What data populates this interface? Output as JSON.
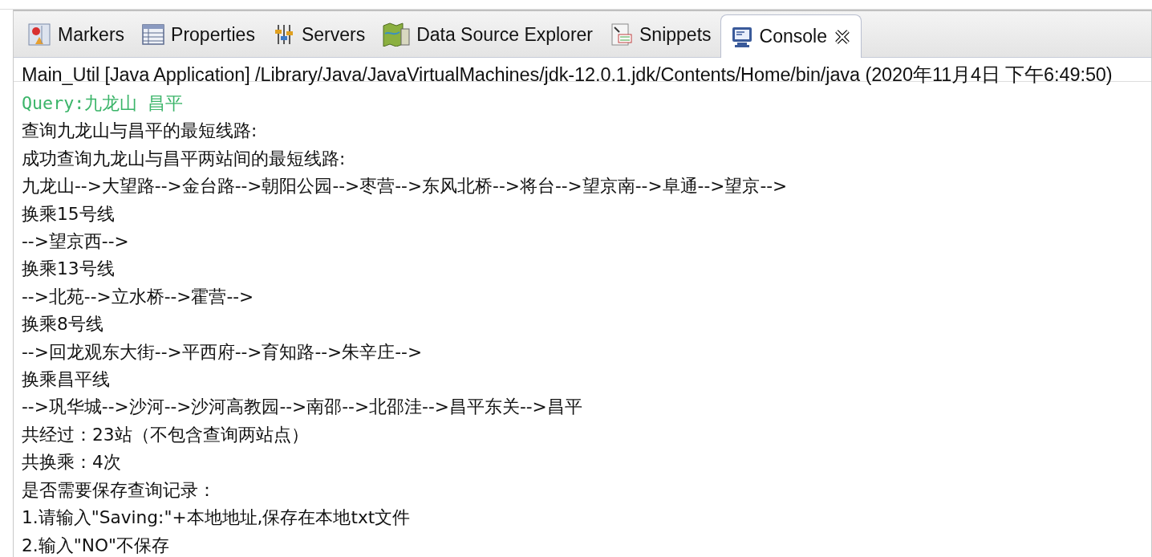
{
  "tabs": [
    {
      "label": "Markers",
      "kind": "markers",
      "selected": false
    },
    {
      "label": "Properties",
      "kind": "properties",
      "selected": false
    },
    {
      "label": "Servers",
      "kind": "servers",
      "selected": false
    },
    {
      "label": "Data Source Explorer",
      "kind": "datasource",
      "selected": false
    },
    {
      "label": "Snippets",
      "kind": "snippets",
      "selected": false
    },
    {
      "label": "Console",
      "kind": "console",
      "selected": true
    }
  ],
  "console": {
    "header": "Main_Util [Java Application] /Library/Java/JavaVirtualMachines/jdk-12.0.1.jdk/Contents/Home/bin/java (2020年11月4日 下午6:49:50)",
    "lines": [
      {
        "kind": "input",
        "text": "Query:九龙山 昌平"
      },
      {
        "kind": "output",
        "text": "查询九龙山与昌平的最短线路:"
      },
      {
        "kind": "output",
        "text": "成功查询九龙山与昌平两站间的最短线路:"
      },
      {
        "kind": "output",
        "text": "九龙山-->大望路-->金台路-->朝阳公园-->枣营-->东风北桥-->将台-->望京南-->阜通-->望京-->"
      },
      {
        "kind": "output",
        "text": "换乘15号线"
      },
      {
        "kind": "output",
        "text": "-->望京西-->"
      },
      {
        "kind": "output",
        "text": "换乘13号线"
      },
      {
        "kind": "output",
        "text": "-->北苑-->立水桥-->霍营-->"
      },
      {
        "kind": "output",
        "text": "换乘8号线"
      },
      {
        "kind": "output",
        "text": "-->回龙观东大街-->平西府-->育知路-->朱辛庄-->"
      },
      {
        "kind": "output",
        "text": "换乘昌平线"
      },
      {
        "kind": "output",
        "text": "-->巩华城-->沙河-->沙河高教园-->南邵-->北邵洼-->昌平东关-->昌平"
      },
      {
        "kind": "output",
        "text": "共经过：23站（不包含查询两站点）"
      },
      {
        "kind": "output",
        "text": "共换乘：4次"
      },
      {
        "kind": "output",
        "text": "是否需要保存查询记录："
      },
      {
        "kind": "output",
        "text": "1.请输入\"Saving:\"+本地地址,保存在本地txt文件"
      },
      {
        "kind": "output",
        "text": "2.输入\"NO\"不保存"
      }
    ]
  }
}
